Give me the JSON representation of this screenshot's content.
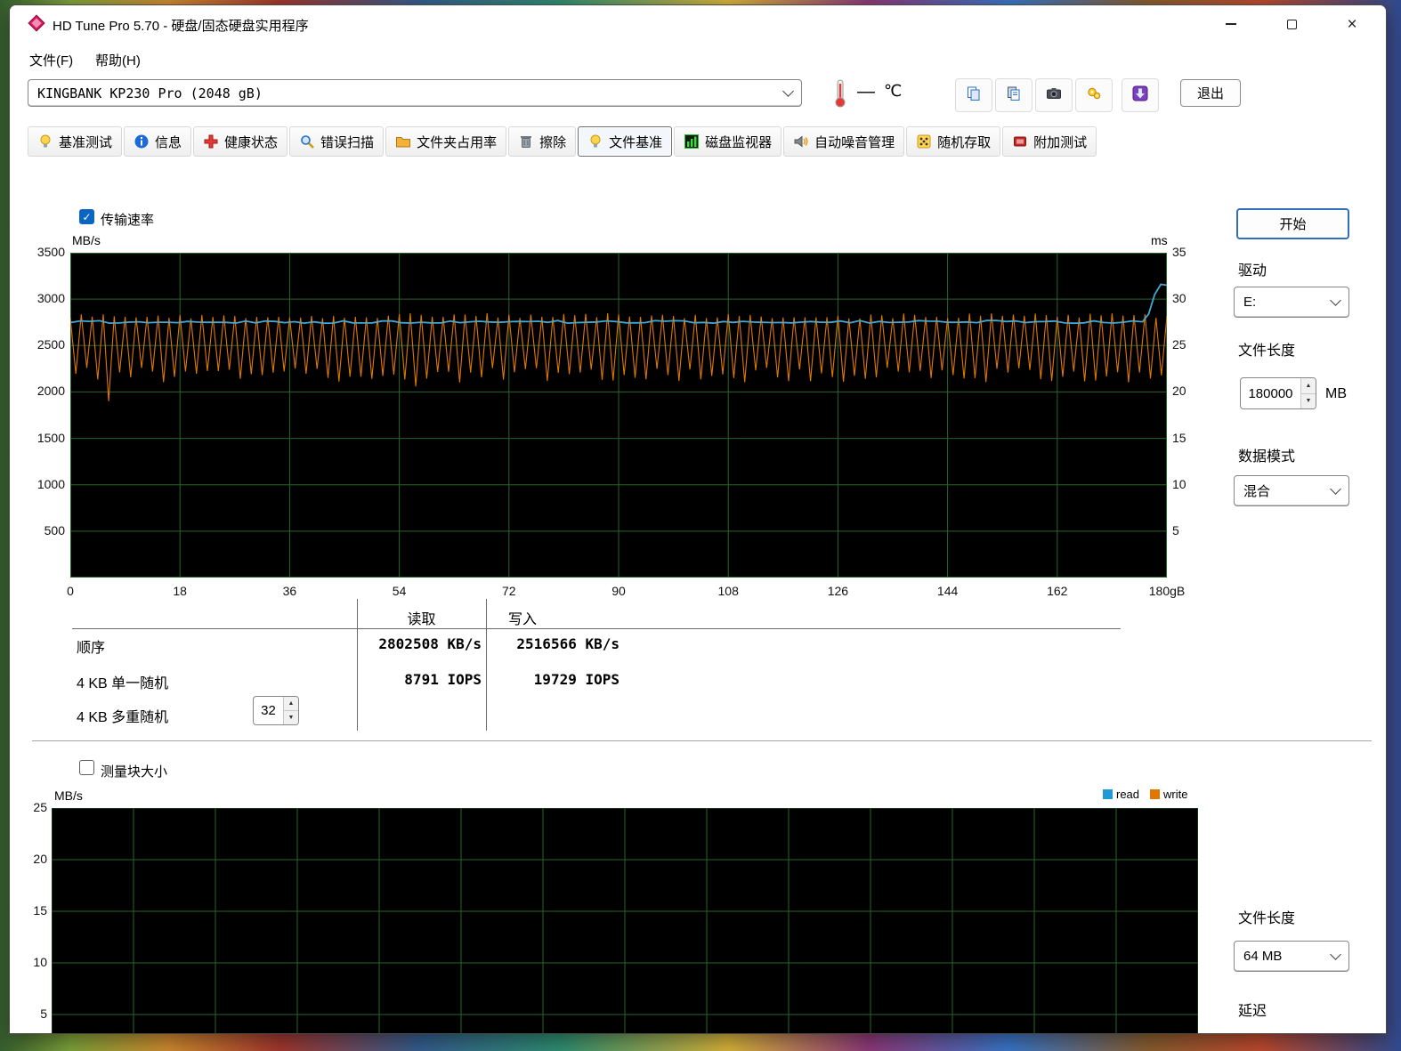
{
  "window": {
    "title": "HD Tune Pro 5.70 - 硬盘/固态硬盘实用程序"
  },
  "menu": {
    "items": [
      {
        "label": "文件(F)"
      },
      {
        "label": "帮助(H)"
      }
    ]
  },
  "toolbar": {
    "drive_select_value": "KINGBANK KP230 Pro (2048 gB)",
    "temperature_dash": "—",
    "temperature_unit": "℃",
    "exit_label": "退出",
    "icon_buttons": [
      "copy",
      "copy-alt",
      "camera",
      "tools",
      "download"
    ]
  },
  "tabs": [
    {
      "id": "benchmark",
      "icon": "benchmark",
      "label": "基准测试"
    },
    {
      "id": "info",
      "icon": "info",
      "label": "信息"
    },
    {
      "id": "health",
      "icon": "health",
      "label": "健康状态"
    },
    {
      "id": "error-scan",
      "icon": "scan",
      "label": "错误扫描"
    },
    {
      "id": "folder-usage",
      "icon": "folder",
      "label": "文件夹占用率"
    },
    {
      "id": "erase",
      "icon": "erase",
      "label": "擦除"
    },
    {
      "id": "file-benchmark",
      "icon": "benchmark",
      "label": "文件基准",
      "active": true
    },
    {
      "id": "disk-monitor",
      "icon": "monitor",
      "label": "磁盘监视器"
    },
    {
      "id": "aam",
      "icon": "speaker",
      "label": "自动噪音管理"
    },
    {
      "id": "random-access",
      "icon": "random",
      "label": "随机存取"
    },
    {
      "id": "extra-tests",
      "icon": "extra",
      "label": "附加测试"
    }
  ],
  "panel": {
    "transfer_checkbox_label": "传输速率",
    "transfer_checked": true,
    "start_button": "开始",
    "drive_label": "驱动",
    "drive_value": "E:",
    "file_length_label": "文件长度",
    "file_length_value": "180000",
    "file_length_unit": "MB",
    "data_mode_label": "数据模式",
    "data_mode_value": "混合",
    "block_checkbox_label": "测量块大小",
    "block_checked": false,
    "bottom_file_length_label": "文件长度",
    "bottom_file_length_value": "64 MB",
    "latency_label": "延迟"
  },
  "results": {
    "read_header": "读取",
    "write_header": "写入",
    "rows": [
      {
        "label": "顺序",
        "read": "2802508 KB/s",
        "write": "2516566 KB/s"
      },
      {
        "label": "4 KB 单一随机",
        "read": "8791 IOPS",
        "write": "19729 IOPS"
      },
      {
        "label": "4 KB 多重随机",
        "queue_depth": "32"
      }
    ]
  },
  "chart_data": [
    {
      "name": "transfer_rate",
      "type": "line",
      "ylabel_left": "MB/s",
      "ylabel_right": "ms",
      "y_left_ticks": [
        3500,
        3000,
        2500,
        2000,
        1500,
        1000,
        500
      ],
      "y_right_ticks": [
        35,
        30,
        25,
        20,
        15,
        10,
        5
      ],
      "x_ticks": [
        0,
        18,
        36,
        54,
        72,
        90,
        108,
        126,
        144,
        162
      ],
      "x_end_label": "180gB",
      "x_range": [
        0,
        180
      ],
      "y_left_range": [
        0,
        3500
      ],
      "y_right_range": [
        0,
        35
      ],
      "background": "#000000",
      "grid_color": "#2a642a",
      "series": [
        {
          "name": "write_speed_MBps",
          "color": "#e07800",
          "pattern": "oscillating",
          "trough_approx": 2150,
          "peak_approx": 2820,
          "dips": [
            [
              5,
              1900
            ],
            [
              57,
              2060
            ]
          ]
        },
        {
          "name": "read_speed_MBps",
          "color": "#46a7d2",
          "pattern": "flat",
          "value_approx": 2755,
          "end_spike": [
            179,
            3160
          ]
        }
      ]
    },
    {
      "name": "block_size",
      "type": "line",
      "ylabel": "MB/s",
      "y_ticks": [
        25,
        20,
        15,
        10,
        5
      ],
      "series": [],
      "legend": [
        {
          "name": "read",
          "color": "#1f9ad6"
        },
        {
          "name": "write",
          "color": "#e07800"
        }
      ],
      "background": "#000000",
      "grid_color": "#2a642a"
    }
  ]
}
